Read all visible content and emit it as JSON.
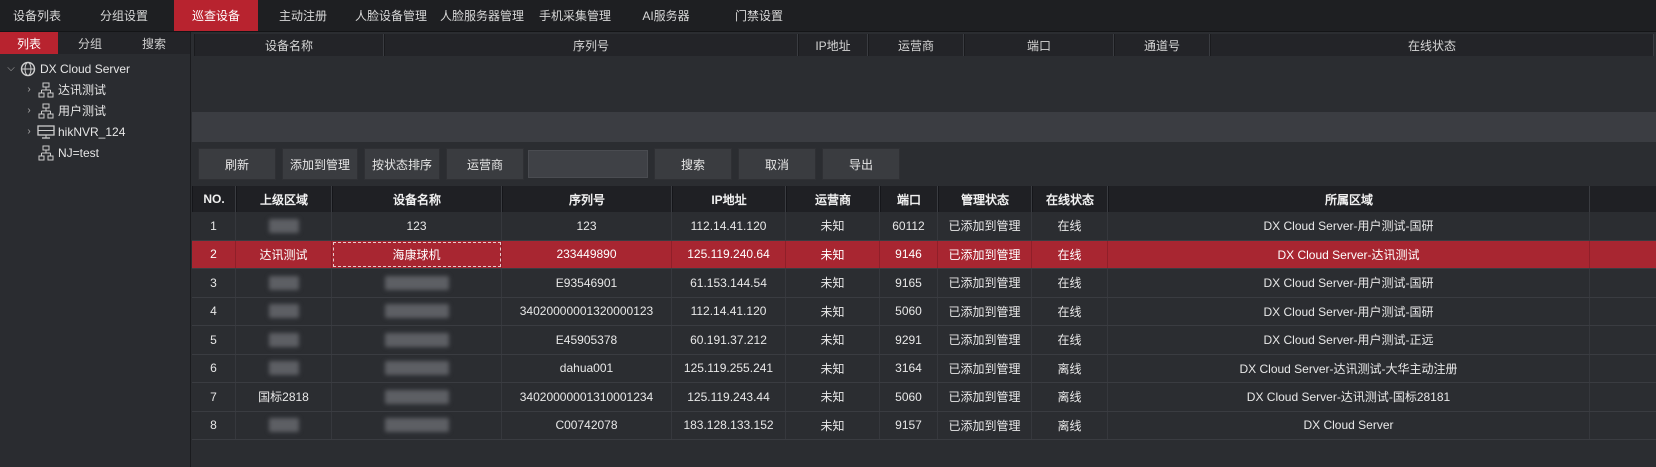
{
  "topnav": {
    "tabs": [
      {
        "label": "设备列表"
      },
      {
        "label": "分组设置"
      },
      {
        "label": "巡查设备",
        "active": true
      },
      {
        "label": "主动注册"
      },
      {
        "label": "人脸设备管理"
      },
      {
        "label": "人脸服务器管理"
      },
      {
        "label": "手机采集管理"
      },
      {
        "label": "AI服务器"
      },
      {
        "label": "门禁设置"
      }
    ]
  },
  "leftpanel": {
    "tabs": [
      {
        "label": "列表",
        "active": true
      },
      {
        "label": "分组"
      },
      {
        "label": "搜索"
      }
    ],
    "tree": {
      "root": {
        "label": "DX Cloud Server",
        "icon": "globe-icon"
      },
      "children": [
        {
          "label": "达讯测试",
          "icon": "org-icon",
          "expandable": true
        },
        {
          "label": "用户测试",
          "icon": "org-icon",
          "expandable": true
        },
        {
          "label": "hikNVR_124",
          "icon": "nvr-icon",
          "expandable": true
        },
        {
          "label": "NJ=test",
          "icon": "org-icon",
          "expandable": false
        }
      ]
    }
  },
  "toptable": {
    "columns": [
      "设备名称",
      "序列号",
      "IP地址",
      "运营商",
      "端口",
      "通道号",
      "在线状态"
    ]
  },
  "toolbar": {
    "refresh": "刷新",
    "add_manage": "添加到管理",
    "sort_status": "按状态排序",
    "carrier": "运营商",
    "search_value": "",
    "search": "搜索",
    "cancel": "取消",
    "export": "导出"
  },
  "grid": {
    "columns": [
      "NO.",
      "上级区域",
      "设备名称",
      "序列号",
      "IP地址",
      "运营商",
      "端口",
      "管理状态",
      "在线状态",
      "所属区域"
    ],
    "rows": [
      {
        "no": "1",
        "parent": "",
        "name": "123",
        "serial": "123",
        "ip": "112.14.41.120",
        "carrier": "未知",
        "port": "60112",
        "manage": "已添加到管理",
        "online": "在线",
        "region": "DX Cloud Server-用户测试-国研",
        "blur_parent": true
      },
      {
        "no": "2",
        "parent": "达讯测试",
        "name": "海康球机",
        "serial": "233449890",
        "ip": "125.119.240.64",
        "carrier": "未知",
        "port": "9146",
        "manage": "已添加到管理",
        "online": "在线",
        "region": "DX Cloud Server-达讯测试",
        "selected": true
      },
      {
        "no": "3",
        "parent": "",
        "name": "",
        "serial": "E93546901",
        "ip": "61.153.144.54",
        "carrier": "未知",
        "port": "9165",
        "manage": "已添加到管理",
        "online": "在线",
        "region": "DX Cloud Server-用户测试-国研",
        "blur_parent": true,
        "blur_name": true
      },
      {
        "no": "4",
        "parent": "",
        "name": "",
        "serial": "34020000001320000123",
        "ip": "112.14.41.120",
        "carrier": "未知",
        "port": "5060",
        "manage": "已添加到管理",
        "online": "在线",
        "region": "DX Cloud Server-用户测试-国研",
        "blur_parent": true,
        "blur_name": true
      },
      {
        "no": "5",
        "parent": "",
        "name": "",
        "serial": "E45905378",
        "ip": "60.191.37.212",
        "carrier": "未知",
        "port": "9291",
        "manage": "已添加到管理",
        "online": "在线",
        "region": "DX Cloud Server-用户测试-正远",
        "blur_parent": true,
        "blur_name": true
      },
      {
        "no": "6",
        "parent": "",
        "name": "",
        "serial": "dahua001",
        "ip": "125.119.255.241",
        "carrier": "未知",
        "port": "3164",
        "manage": "已添加到管理",
        "online": "离线",
        "region": "DX Cloud Server-达讯测试-大华主动注册",
        "blur_parent": true,
        "blur_name": true
      },
      {
        "no": "7",
        "parent": "国标2818",
        "name": "",
        "serial": "34020000001310001234",
        "ip": "125.119.243.44",
        "carrier": "未知",
        "port": "5060",
        "manage": "已添加到管理",
        "online": "离线",
        "region": "DX Cloud Server-达讯测试-国标28181",
        "blur_name": true
      },
      {
        "no": "8",
        "parent": "",
        "name": "",
        "serial": "C00742078",
        "ip": "183.128.133.152",
        "carrier": "未知",
        "port": "9157",
        "manage": "已添加到管理",
        "online": "离线",
        "region": "DX Cloud Server",
        "blur_parent": true,
        "blur_name": true
      }
    ]
  },
  "colors": {
    "accent": "#b8232f",
    "selected_row": "#a82631",
    "background": "#2b2d31"
  }
}
